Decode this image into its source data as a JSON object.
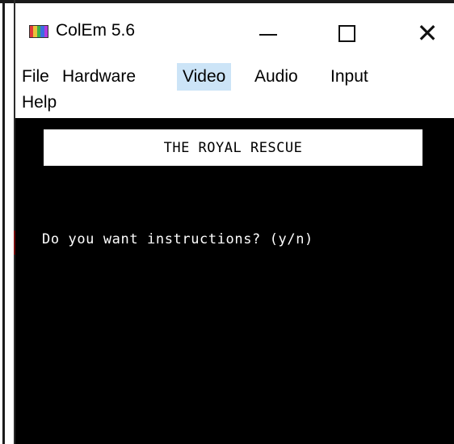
{
  "window": {
    "title": "ColEm 5.6",
    "icon": "colem-app-icon",
    "controls": {
      "minimize_icon": "minimize-icon",
      "maximize_icon": "maximize-icon",
      "close_icon": "close-icon",
      "close_glyph": "✕"
    }
  },
  "menu": {
    "items": [
      {
        "label": "File"
      },
      {
        "label": "Hardware"
      },
      {
        "label": "Video"
      },
      {
        "label": "Audio"
      },
      {
        "label": "Input"
      },
      {
        "label": "Help"
      }
    ],
    "active": "Video",
    "highlight_color": "#cce4f7"
  },
  "screen": {
    "banner": "THE ROYAL RESCUE",
    "prompt": "Do you want instructions? (y/n)",
    "background_color": "#000000",
    "text_color": "#ffffff"
  }
}
